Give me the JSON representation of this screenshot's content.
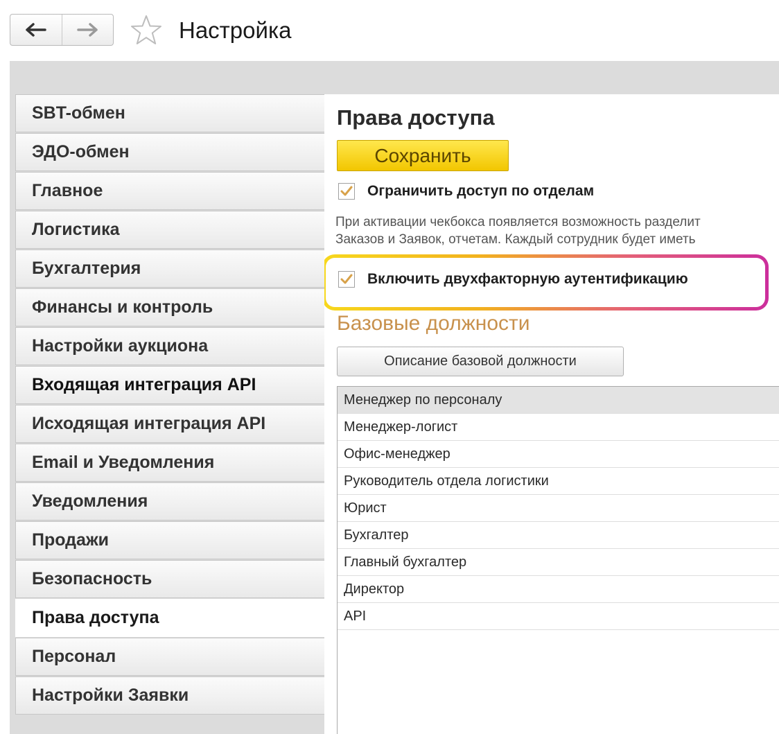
{
  "window": {
    "title": "Настройка"
  },
  "icons": {
    "back": "arrow-left-icon",
    "forward": "arrow-right-icon",
    "favorite": "star-icon",
    "check": "checkmark-icon"
  },
  "colors": {
    "save_button": "#f5d20f",
    "section_title": "#c8914d",
    "highlight_gradient": [
      "#f7d81d",
      "#cc2e9c"
    ]
  },
  "sidebar": {
    "items": [
      {
        "label": "SBT-обмен"
      },
      {
        "label": "ЭДО-обмен"
      },
      {
        "label": "Главное"
      },
      {
        "label": "Логистика"
      },
      {
        "label": "Бухгалтерия"
      },
      {
        "label": "Финансы и контроль"
      },
      {
        "label": "Настройки аукциона"
      },
      {
        "label": "Входящая интеграция API"
      },
      {
        "label": "Исходящая интеграция API"
      },
      {
        "label": "Email и Уведомления"
      },
      {
        "label": "Уведомления"
      },
      {
        "label": "Продажи"
      },
      {
        "label": "Безопасность"
      },
      {
        "label": "Права доступа"
      },
      {
        "label": "Персонал"
      },
      {
        "label": "Настройки Заявки"
      }
    ],
    "active_index": 13
  },
  "main": {
    "title": "Права доступа",
    "save_label": "Сохранить",
    "restrict_by_department": {
      "label": "Ограничить доступ по отделам",
      "checked": true
    },
    "hint_lines": [
      "При активации чекбокса появляется возможность разделит",
      "Заказов и Заявок, отчетам. Каждый сотрудник будет иметь"
    ],
    "two_factor": {
      "label": "Включить двухфакторную аутентификацию",
      "checked": true
    },
    "section_title": "Базовые должности",
    "description_button": "Описание базовой должности",
    "positions": [
      "Менеджер по персоналу",
      "Менеджер-логист",
      "Офис-менеджер",
      "Руководитель отдела логистики",
      "Юрист",
      "Бухгалтер",
      "Главный бухгалтер",
      "Директор",
      "API"
    ],
    "selected_position_index": 0
  }
}
